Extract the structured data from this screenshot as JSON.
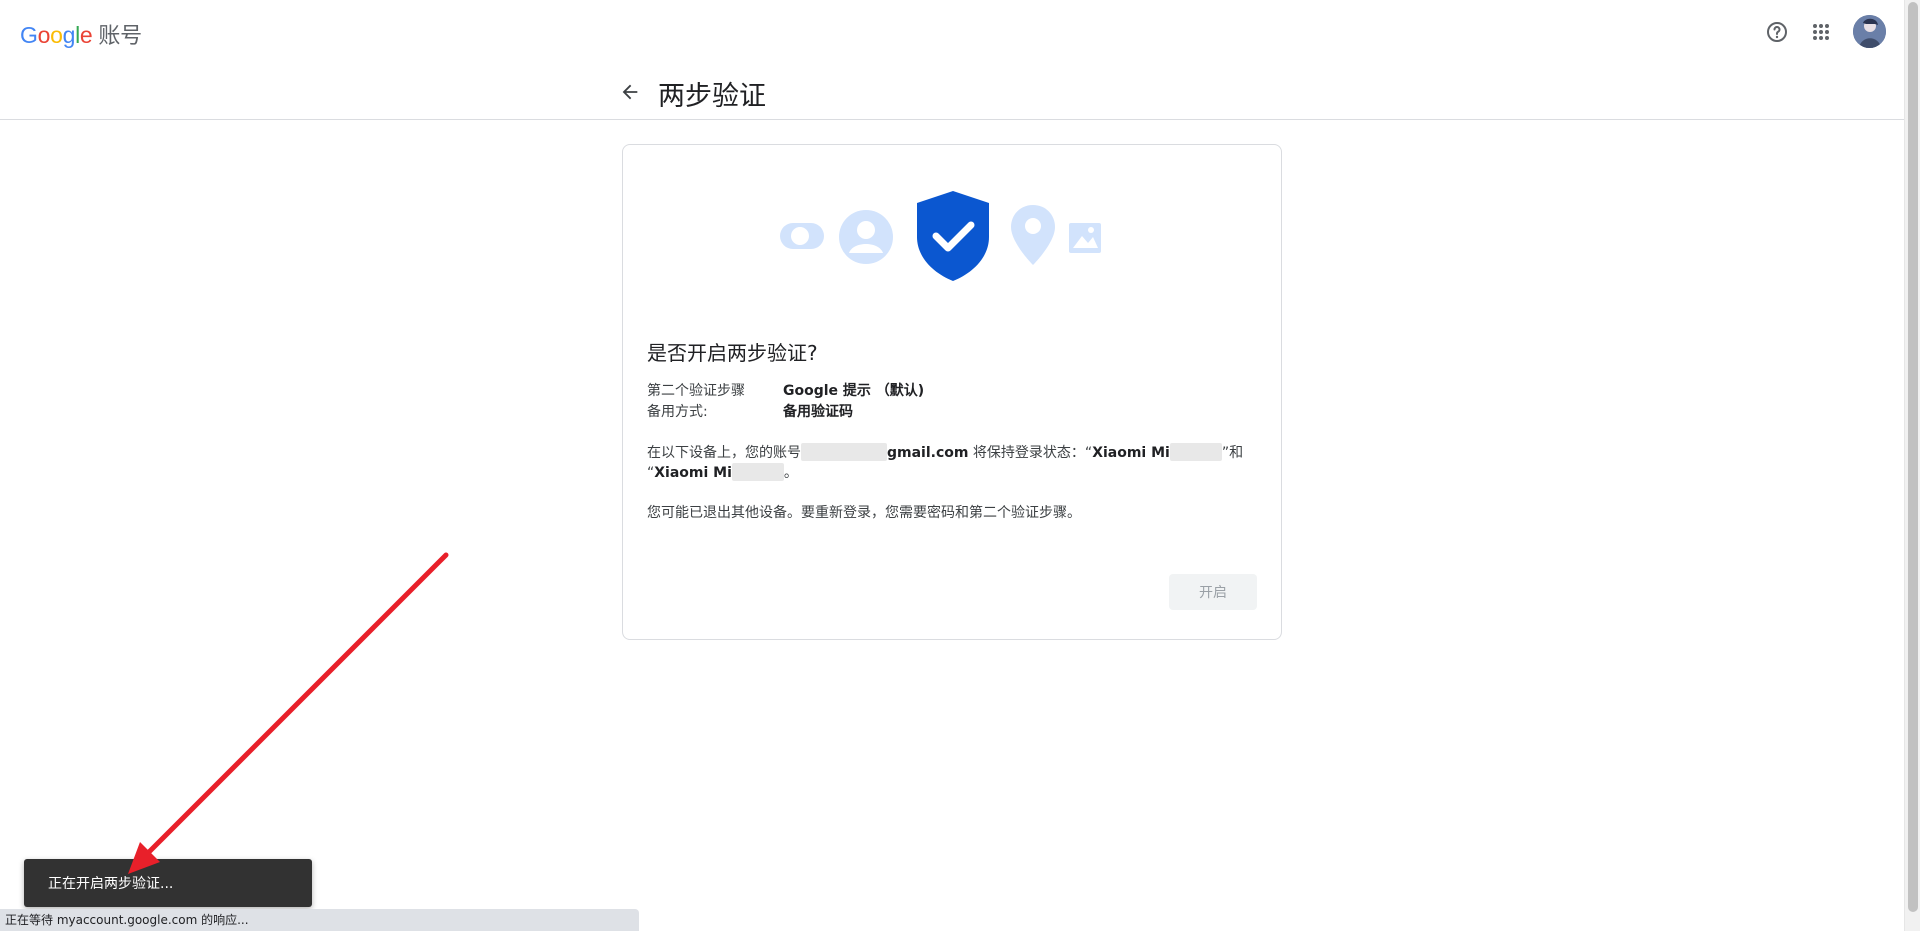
{
  "header": {
    "logo_parts": [
      "G",
      "o",
      "o",
      "g",
      "l",
      "e"
    ],
    "product": "账号",
    "help_icon": "help-circle-icon",
    "apps_icon": "apps-grid-icon"
  },
  "page": {
    "title": "两步验证",
    "back_icon": "arrow-back-icon"
  },
  "card": {
    "heading": "是否开启两步验证?",
    "rows": [
      {
        "label": "第二个验证步骤",
        "value": "Google 提示 （默认)"
      },
      {
        "label": "备用方式:",
        "value": "备用验证码"
      }
    ],
    "para1_prefix": "在以下设备上，您的账号",
    "para1_email_suffix": "gmail.com",
    "para1_middle": " 将保持登录状态：“",
    "device1": "Xiaomi Mi",
    "para1_join": "”和",
    "device2_prefix": "“",
    "device2": "Xiaomi Mi",
    "para1_end": "。",
    "para2": "您可能已退出其他设备。要重新登录，您需要密码和第二个验证步骤。",
    "enable_button": "开启"
  },
  "snackbar": {
    "text": "正在开启两步验证..."
  },
  "statusbar": {
    "text": "正在等待 myaccount.google.com 的响应..."
  },
  "colors": {
    "shield": "#0b57d0",
    "light_icon": "#d2e3fc",
    "snackbar_bg": "#323232",
    "arrow": "#e8202a"
  }
}
